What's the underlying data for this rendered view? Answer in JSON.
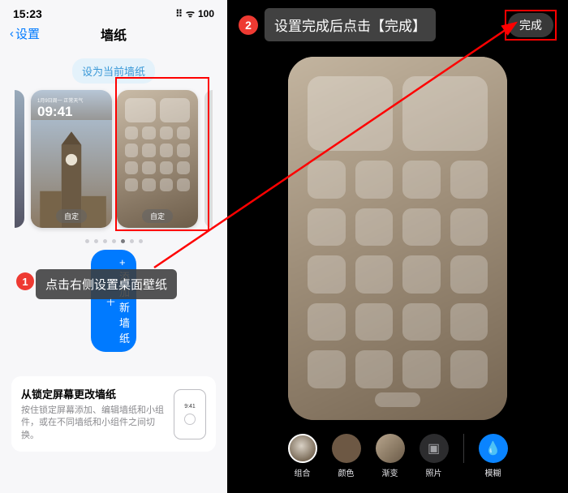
{
  "status": {
    "time": "15:23",
    "signal": "⠿",
    "wifi": "ᯤ",
    "battery": "100"
  },
  "nav": {
    "back": "设置",
    "title": "墙纸"
  },
  "set_current": "设为当前墙纸",
  "lock_preview": {
    "date": "1月9日周一 正常天气",
    "time": "09:41",
    "custom": "自定"
  },
  "home_preview": {
    "custom": "自定"
  },
  "add_new": "+ 添加新墙纸",
  "steps": {
    "s1": {
      "num": "1",
      "text": "点击右侧设置桌面壁纸"
    },
    "s2": {
      "num": "2",
      "text": "设置完成后点击【完成】"
    }
  },
  "bottom_card": {
    "title": "从锁定屏幕更改墙纸",
    "desc": "按住锁定屏幕添加、编辑墙纸和小组件，或在不同墙纸和小组件之间切换。",
    "mini_time": "9:41"
  },
  "right": {
    "done": "完成",
    "tools": {
      "combo": "组合",
      "color": "颜色",
      "grad": "渐变",
      "photo": "照片",
      "blur": "模糊"
    }
  }
}
